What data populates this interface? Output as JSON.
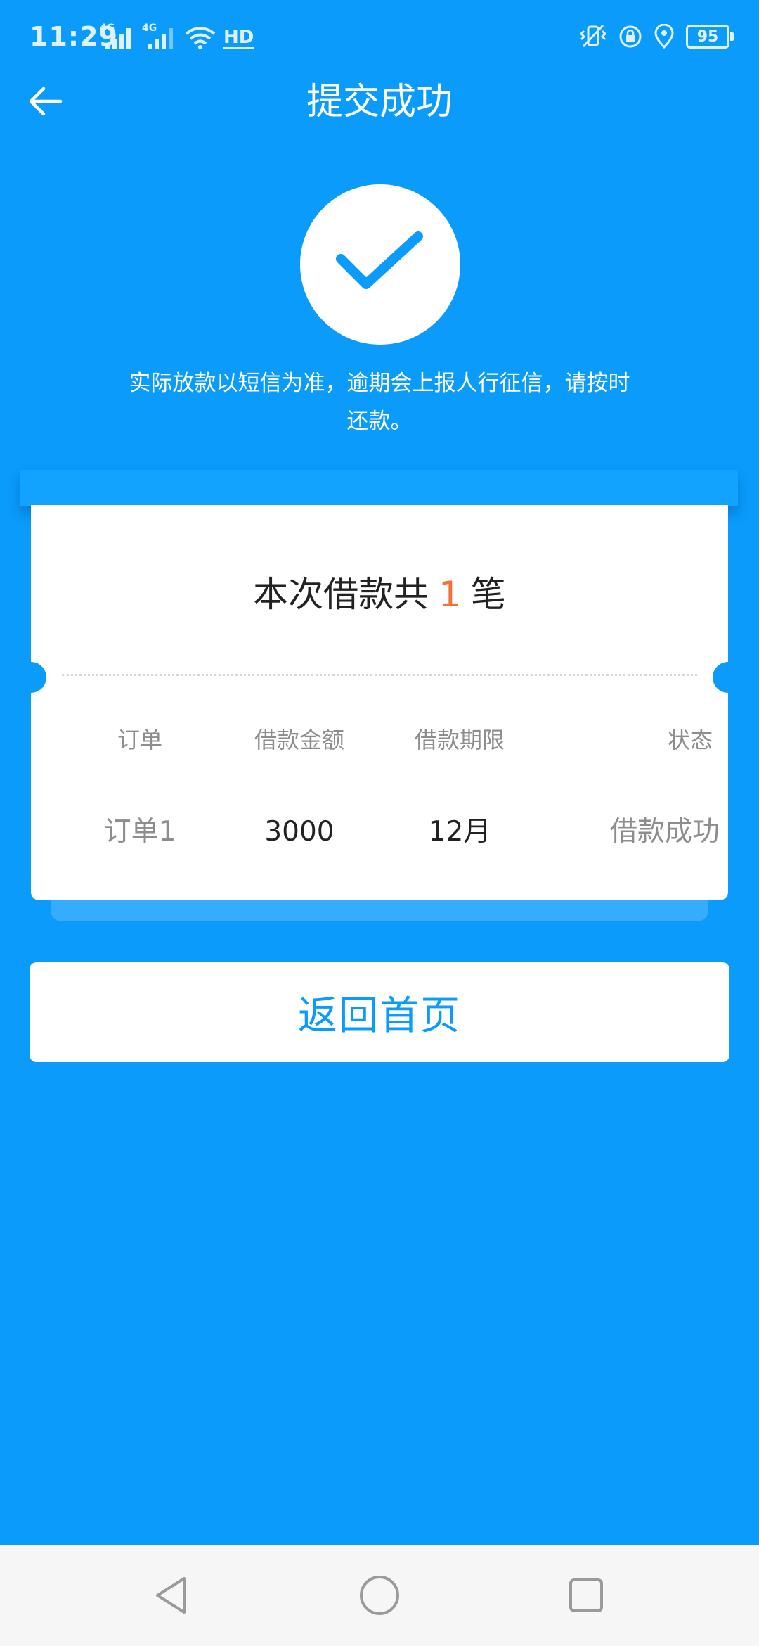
{
  "status_bar": {
    "time": "11:29",
    "signal1_label": "4G",
    "signal2_label": "4G",
    "hd_label": "HD",
    "battery": "95"
  },
  "header": {
    "title": "提交成功",
    "back_icon": "arrow-left-icon"
  },
  "success": {
    "icon": "checkmark-icon",
    "notice_line1": "实际放款以短信为准，逾期会上报人行征信，请按时",
    "notice_line2": "还款。"
  },
  "summary": {
    "prefix": "本次借款共",
    "count": "1",
    "suffix": "笔"
  },
  "table": {
    "headers": [
      "订单",
      "借款金额",
      "借款期限",
      "状态"
    ],
    "rows": [
      [
        "订单1",
        "3000",
        "12月",
        "借款成功"
      ]
    ]
  },
  "actions": {
    "home_label": "返回首页"
  },
  "colors": {
    "primary": "#0a9bfb",
    "accent": "#f2703a",
    "card": "#ffffff"
  }
}
